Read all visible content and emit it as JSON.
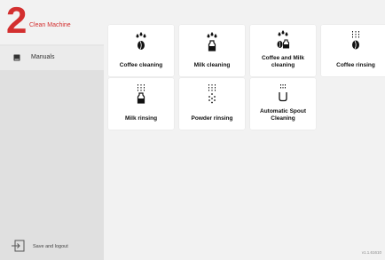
{
  "brand": {
    "number": "2",
    "name": "Clean Machine"
  },
  "sidebar": {
    "items": [
      {
        "label": "Manuals"
      }
    ],
    "logout_label": "Save and logout"
  },
  "cards": [
    {
      "label": "Coffee cleaning"
    },
    {
      "label": "Milk cleaning"
    },
    {
      "label": "Coffee and Milk cleaning"
    },
    {
      "label": "Coffee rinsing"
    },
    {
      "label": "Milk rinsing"
    },
    {
      "label": "Powder rinsing"
    },
    {
      "label": "Automatic Spout Cleaning"
    }
  ],
  "version": "v1.1.61610",
  "colors": {
    "brand": "#d32f2f",
    "card": "#ffffff",
    "background": "#f2f2f2",
    "sidebar": "#e0e0e0"
  }
}
